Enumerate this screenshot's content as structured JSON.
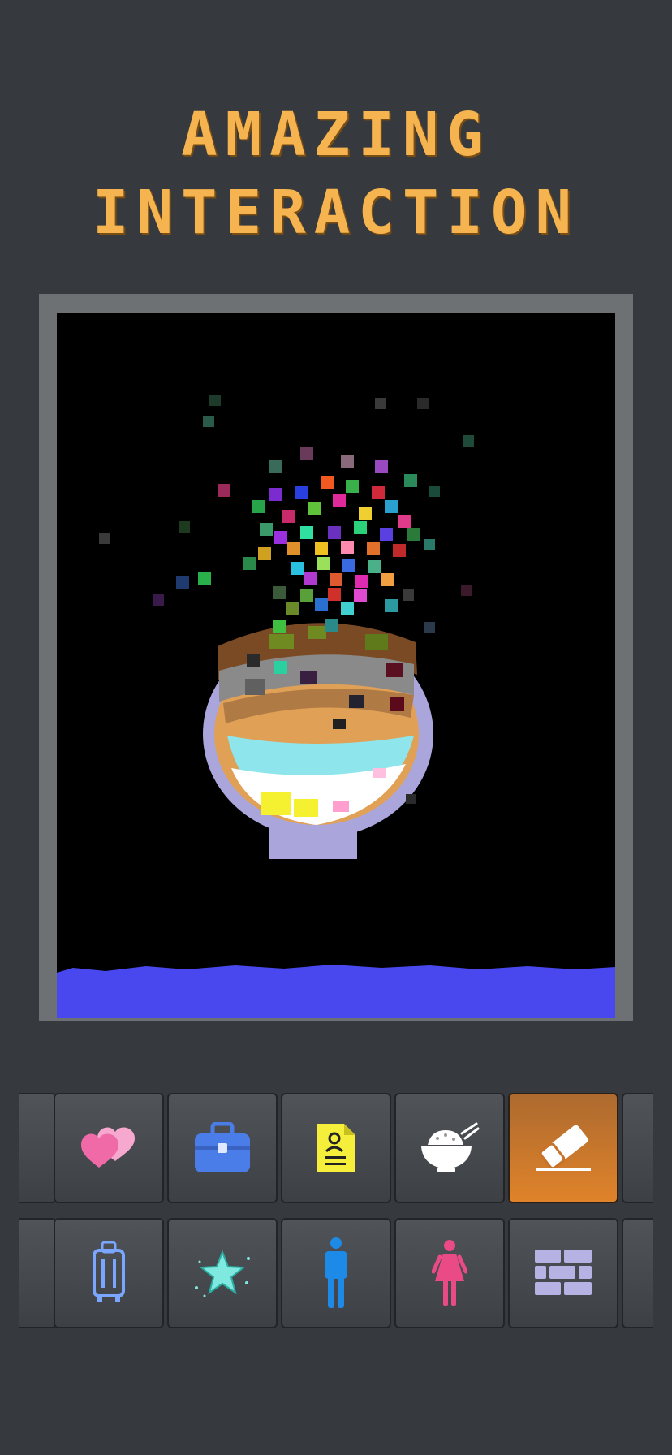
{
  "headline": {
    "line1": "AMAZING",
    "line2": "INTERACTION"
  },
  "colors": {
    "background": "#36393d",
    "headline": "#f5b44f",
    "frame": "#6e7174",
    "canvas": "#000000",
    "water": "#4848ee",
    "bowl": "#aaa6dc",
    "selected_tool": "#e0832a"
  },
  "tools_row_1": [
    {
      "name": "partial-tool",
      "icon": "partial-icon"
    },
    {
      "name": "hearts-tool",
      "icon": "hearts-icon"
    },
    {
      "name": "briefcase-tool",
      "icon": "briefcase-icon"
    },
    {
      "name": "document-tool",
      "icon": "id-document-icon"
    },
    {
      "name": "rice-bowl-tool",
      "icon": "rice-bowl-icon"
    },
    {
      "name": "eraser-tool",
      "icon": "eraser-icon",
      "selected": true
    },
    {
      "name": "partial-tool",
      "icon": "partial-icon"
    }
  ],
  "tools_row_2": [
    {
      "name": "partial-tool",
      "icon": "partial-icon"
    },
    {
      "name": "suitcase-tool",
      "icon": "suitcase-icon"
    },
    {
      "name": "star-tool",
      "icon": "sparkle-star-icon"
    },
    {
      "name": "man-tool",
      "icon": "man-icon"
    },
    {
      "name": "woman-tool",
      "icon": "woman-icon"
    },
    {
      "name": "brick-wall-tool",
      "icon": "brick-wall-icon"
    },
    {
      "name": "partial-tool",
      "icon": "partial-icon"
    }
  ]
}
